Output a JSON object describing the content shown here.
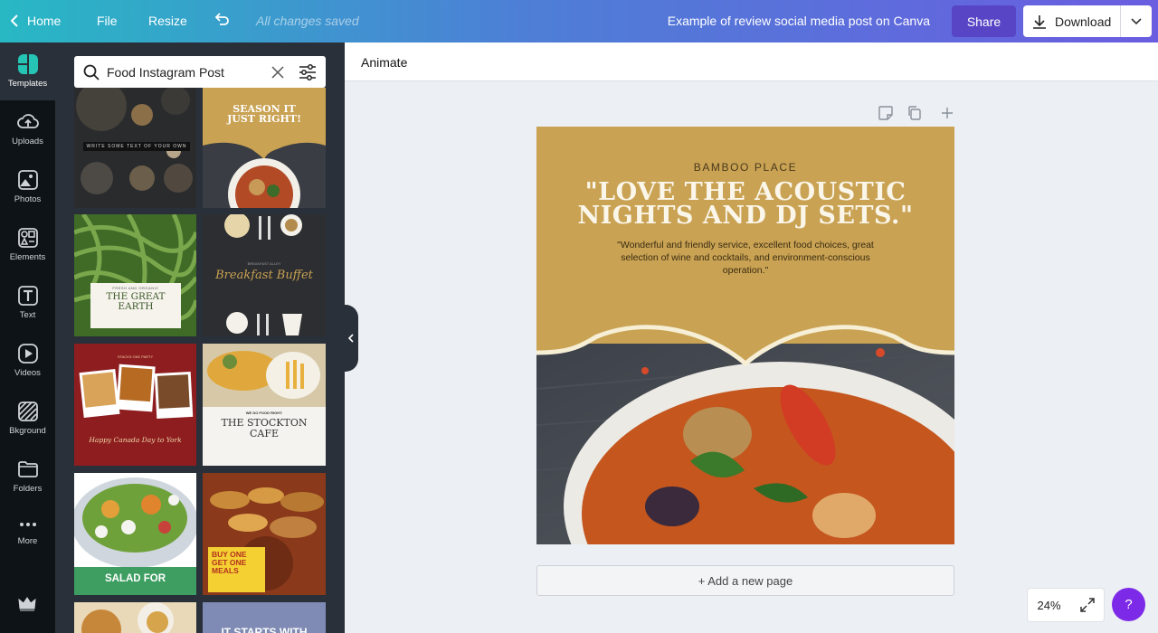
{
  "topbar": {
    "home_label": "Home",
    "file_label": "File",
    "resize_label": "Resize",
    "saved_status": "All changes saved",
    "doc_title": "Example of review social media post on Canva",
    "share_label": "Share",
    "download_label": "Download"
  },
  "nav": {
    "items": [
      {
        "label": "Templates",
        "icon": "templates-icon"
      },
      {
        "label": "Uploads",
        "icon": "uploads-icon"
      },
      {
        "label": "Photos",
        "icon": "photos-icon"
      },
      {
        "label": "Elements",
        "icon": "elements-icon"
      },
      {
        "label": "Text",
        "icon": "text-icon"
      },
      {
        "label": "Videos",
        "icon": "videos-icon"
      },
      {
        "label": "Bkground",
        "icon": "background-icon"
      },
      {
        "label": "Folders",
        "icon": "folders-icon"
      },
      {
        "label": "More",
        "icon": "more-icon"
      }
    ]
  },
  "search": {
    "value": "Food Instagram Post"
  },
  "templates": [
    {
      "title": "WRITE SOME TEXT OF YOUR OWN"
    },
    {
      "title": "SEASON IT JUST RIGHT!"
    },
    {
      "title": "THE GREAT EARTH",
      "subtitle": "FRESH AND ORGANIC"
    },
    {
      "title": "Breakfast Buffet",
      "subtitle": "BREAKFAST ALLEY"
    },
    {
      "title": "Happy Canada Day to York",
      "subtitle": "STACKS OKE PARTY"
    },
    {
      "title": "THE STOCKTON CAFE",
      "subtitle": "WE DO FOOD RIGHT."
    },
    {
      "title": "SALAD FOR BREAKFAST?"
    },
    {
      "title": "BUY ONE GET ONE MEALS"
    },
    {
      "title": ""
    },
    {
      "title": "IT STARTS WITH"
    }
  ],
  "toolbar": {
    "animate_label": "Animate"
  },
  "post": {
    "venue": "BAMBOO PLACE",
    "quote": "\"LOVE THE ACOUSTIC NIGHTS AND DJ SETS.\"",
    "review": "\"Wonderful and friendly service, excellent food choices, great selection of wine and cocktails, and environment-conscious operation.\""
  },
  "add_page_label": "+ Add a new page",
  "zoom_label": "24%",
  "help_label": "?",
  "colors": {
    "post_bg": "#c9a253",
    "share_bg": "#5845c6",
    "help_bg": "#7d2ae8"
  }
}
